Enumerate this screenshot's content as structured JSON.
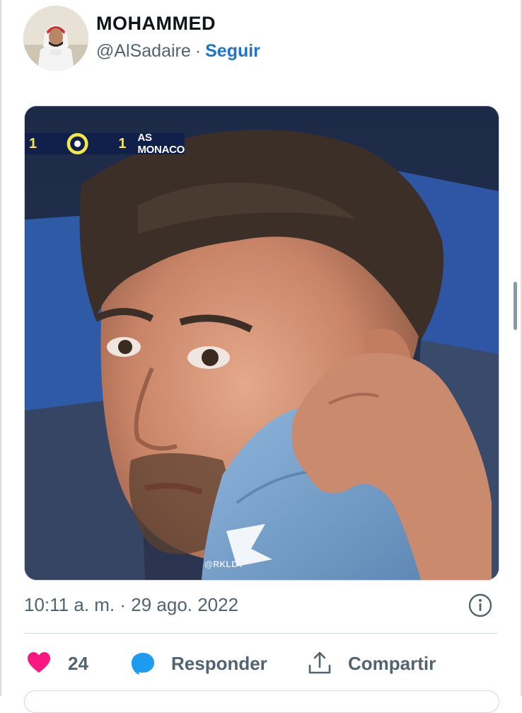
{
  "author": {
    "name": "MOHAMMED",
    "handle": "@AlSadaire",
    "separator": "·",
    "follow_label": "Seguir"
  },
  "media": {
    "scoreboard": {
      "home_score": "1",
      "away_score": "1",
      "away_team": "AS MONACO",
      "league_icon": "ligue1-logo-icon"
    },
    "watermark": "@RKLDY"
  },
  "timestamp": "10:11 a. m. · 29 ago. 2022",
  "actions": {
    "like_count": "24",
    "reply_label": "Responder",
    "share_label": "Compartir"
  },
  "colors": {
    "accent": "#1d75c9",
    "like": "#f91880",
    "reply": "#1d9bf0",
    "muted_text": "#536471",
    "score_yellow": "#f3e84a",
    "scoreboard_bg": "#10204a"
  },
  "icons": {
    "info": "info-icon",
    "like": "heart-icon",
    "reply": "speech-bubble-icon",
    "share": "share-upload-icon"
  }
}
